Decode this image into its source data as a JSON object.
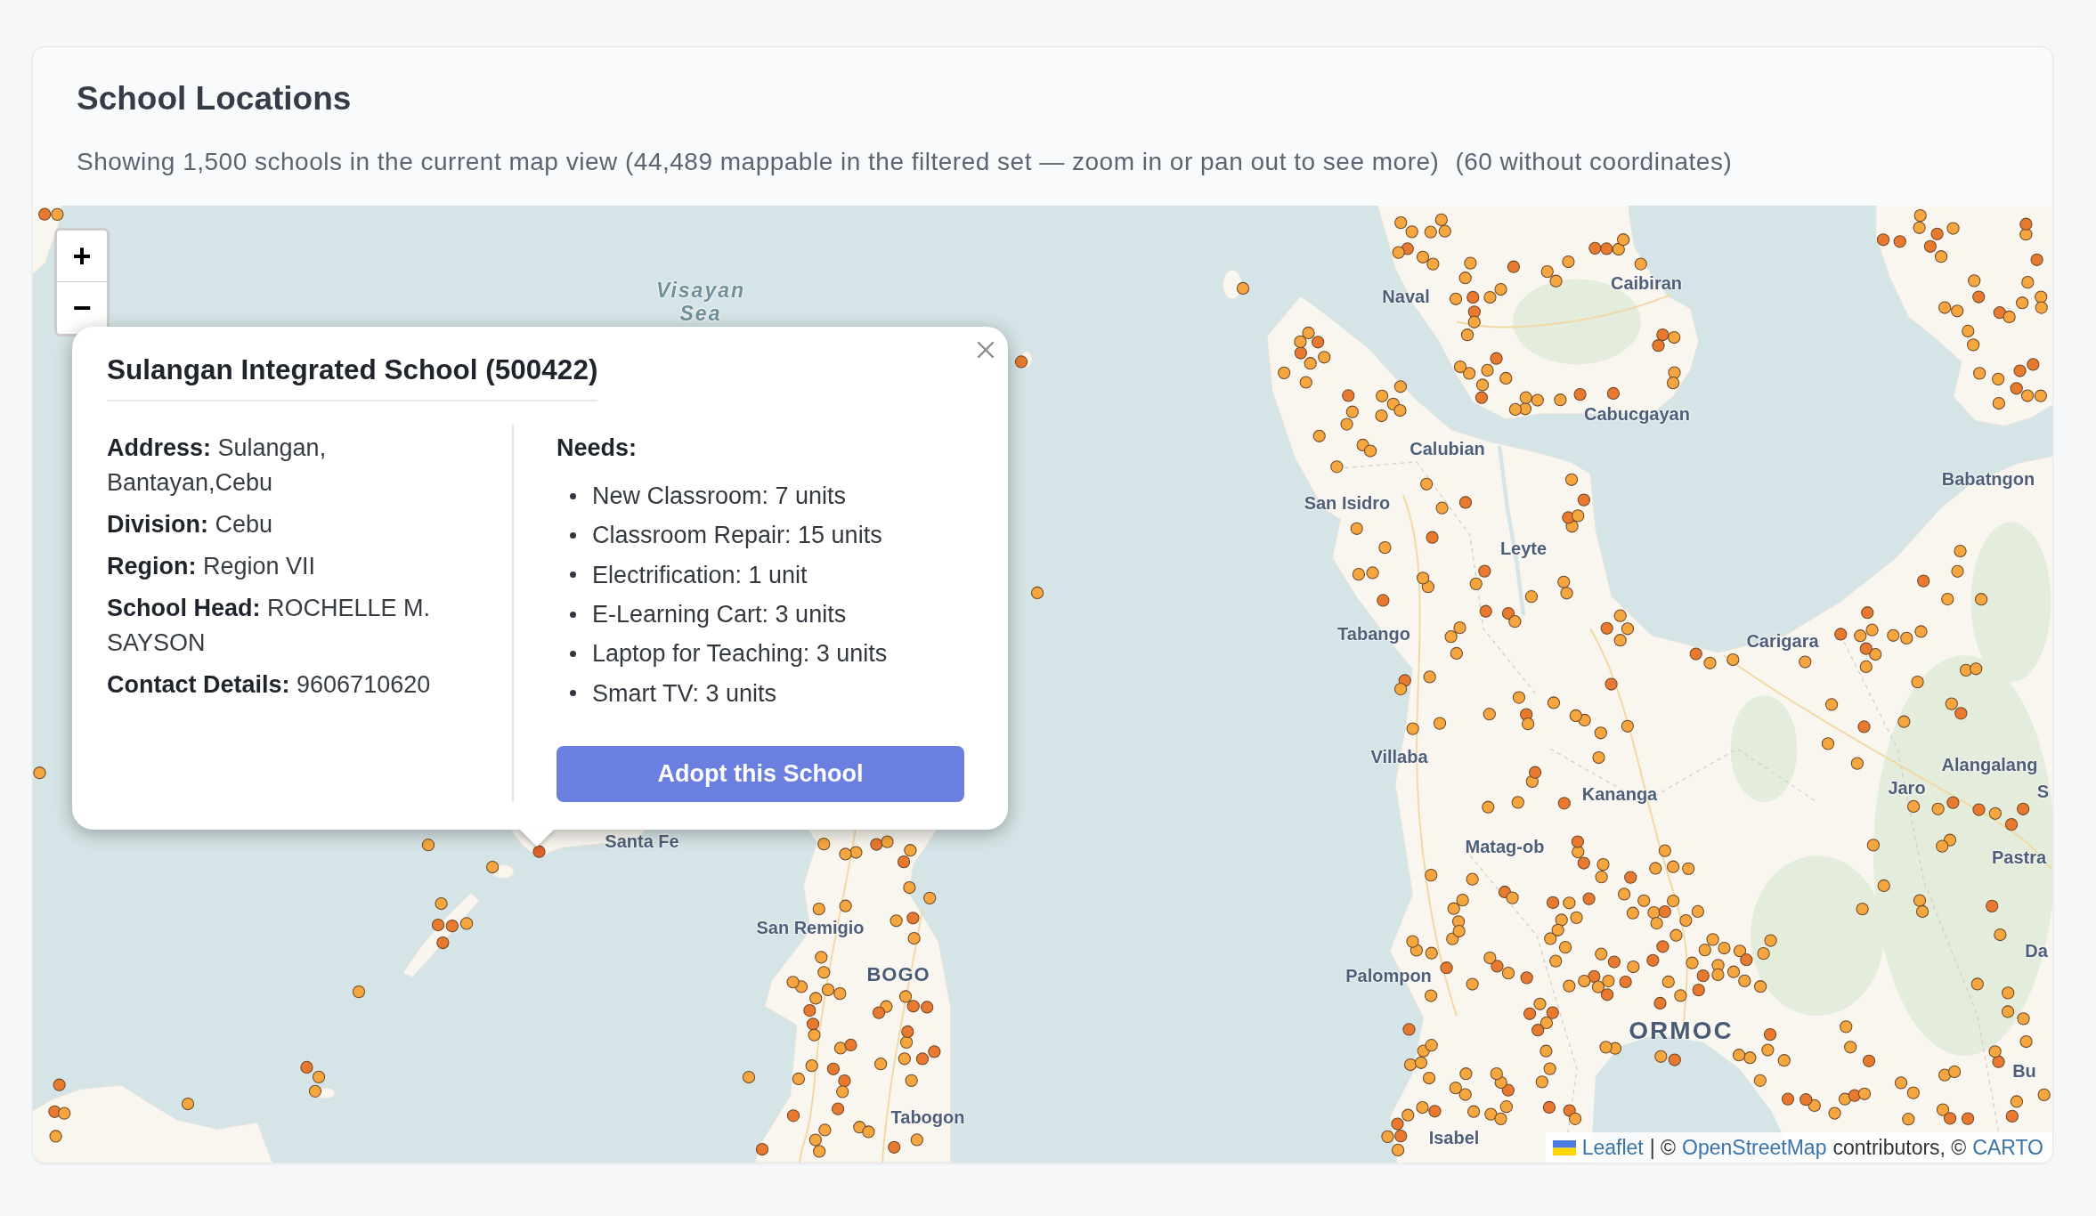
{
  "card": {
    "title": "School Locations",
    "summary": "Showing 1,500 schools in the current map view (44,489 mappable in the filtered set — zoom in or pan out to see more)",
    "missing_note": "(60 without coordinates)"
  },
  "map": {
    "zoom_controls": [
      {
        "label": "+"
      },
      {
        "label": "−"
      }
    ],
    "labels": [
      {
        "text": "Visayan Sea",
        "kind": "water"
      },
      {
        "text": "Naval",
        "kind": "town"
      },
      {
        "text": "Caibiran",
        "kind": "town"
      },
      {
        "text": "Cabucgayan",
        "kind": "town"
      },
      {
        "text": "Calubian",
        "kind": "town"
      },
      {
        "text": "Babatngon",
        "kind": "town"
      },
      {
        "text": "San Isidro",
        "kind": "town"
      },
      {
        "text": "Leyte",
        "kind": "town"
      },
      {
        "text": "Tabango",
        "kind": "town"
      },
      {
        "text": "Carigara",
        "kind": "town"
      },
      {
        "text": "Villaba",
        "kind": "town"
      },
      {
        "text": "Alangalang",
        "kind": "town"
      },
      {
        "text": "Kananga",
        "kind": "town"
      },
      {
        "text": "Jaro",
        "kind": "town"
      },
      {
        "text": "S",
        "kind": "town"
      },
      {
        "text": "Santa Fe",
        "kind": "town"
      },
      {
        "text": "Matag-ob",
        "kind": "town"
      },
      {
        "text": "Pastra",
        "kind": "town"
      },
      {
        "text": "San Remigio",
        "kind": "town"
      },
      {
        "text": "Da",
        "kind": "town"
      },
      {
        "text": "BOGO",
        "kind": "city"
      },
      {
        "text": "Palompon",
        "kind": "town"
      },
      {
        "text": "ORMOC",
        "kind": "metro"
      },
      {
        "text": "Bu",
        "kind": "town"
      },
      {
        "text": "Tabogon",
        "kind": "town"
      },
      {
        "text": "Isabel",
        "kind": "town"
      }
    ],
    "popup": {
      "title": "Sulangan Integrated School (500422)",
      "details": [
        "**Address:** Sulangan, Bantayan,Cebu",
        "**Division:** Cebu",
        "**Region:** Region VII",
        "**School Head:** ROCHELLE M. SAYSON",
        "**Contact Details:** 9606710620"
      ],
      "needs_heading": "Needs:",
      "needs": [
        "New Classroom: 7 units",
        "Classroom Repair: 15 units",
        "Electrification: 1 unit",
        "E-Learning Cart: 3 units",
        "Laptop for Teaching: 3 units",
        "Smart TV: 3 units"
      ],
      "button": "Adopt this School"
    },
    "attribution": [
      {
        "kind": "link",
        "text": "Leaflet"
      },
      {
        "kind": "text",
        "text": "| ©"
      },
      {
        "kind": "link",
        "text": "OpenStreetMap"
      },
      {
        "kind": "text",
        "text": "contributors, ©"
      },
      {
        "kind": "link",
        "text": "CARTO"
      }
    ]
  }
}
